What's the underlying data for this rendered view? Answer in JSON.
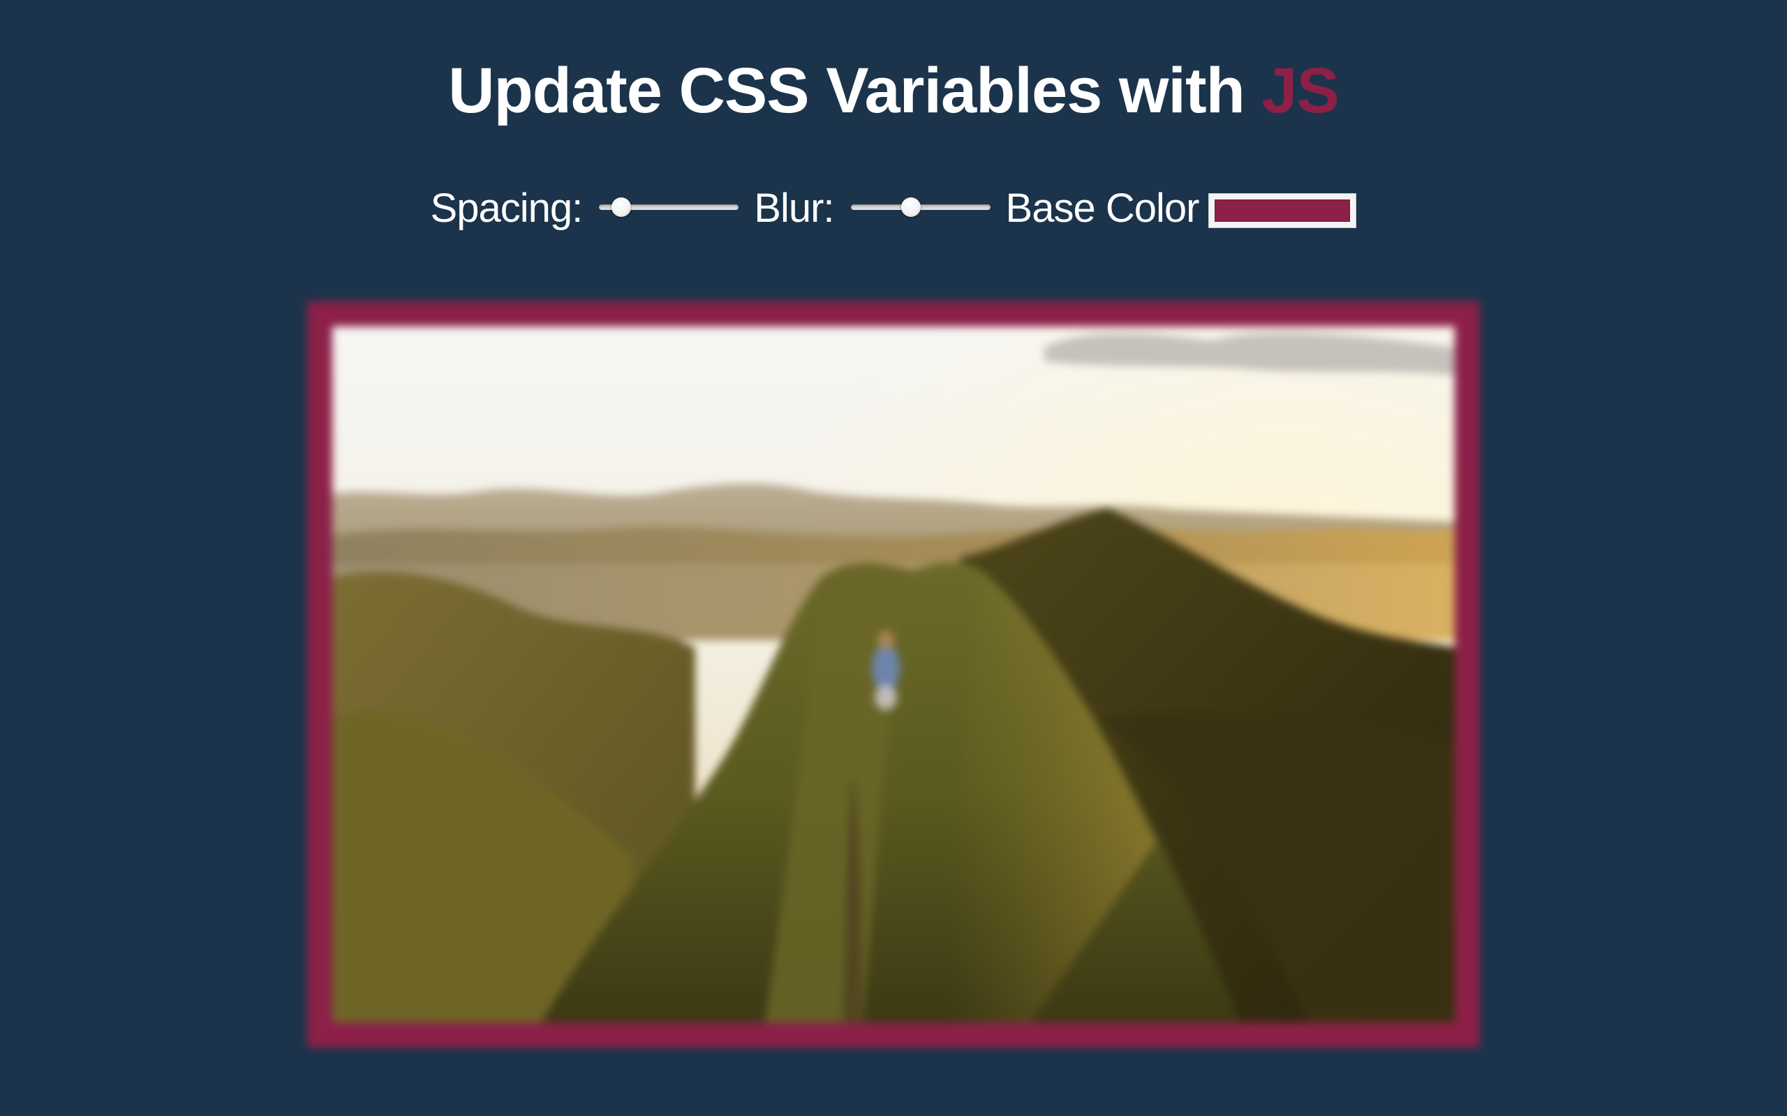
{
  "header": {
    "title_prefix": "Update CSS Variables with",
    "title_accent": "JS"
  },
  "controls": {
    "spacing": {
      "label": "Spacing:",
      "value": 10,
      "min": 10,
      "max": 200
    },
    "blur": {
      "label": "Blur:",
      "value": 10,
      "min": 0,
      "max": 25
    },
    "base_color": {
      "label": "Base Color",
      "value": "#8c2048"
    }
  },
  "colors": {
    "background": "#1b344b",
    "accent": "#8c2048",
    "text": "#ffffff"
  },
  "image": {
    "description_icon": "mountain-photo"
  }
}
